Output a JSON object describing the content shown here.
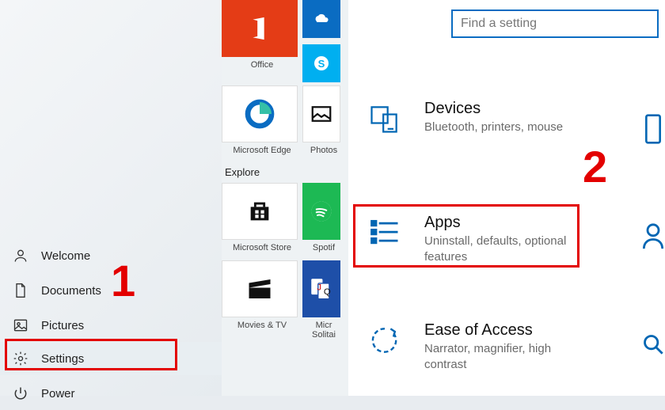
{
  "start": {
    "welcome": "Welcome",
    "documents": "Documents",
    "pictures": "Pictures",
    "settings": "Settings",
    "power": "Power"
  },
  "tiles": {
    "office": "Office",
    "edge": "Microsoft Edge",
    "photos": "Photos",
    "explore": "Explore",
    "store": "Microsoft Store",
    "spotify": "Spotif",
    "movies": "Movies & TV",
    "solitaire": "Micr\nSolitai"
  },
  "settings_window": {
    "search_placeholder": "Find a setting",
    "devices": {
      "title": "Devices",
      "sub": "Bluetooth, printers, mouse"
    },
    "apps": {
      "title": "Apps",
      "sub": "Uninstall, defaults, optional features"
    },
    "ease": {
      "title": "Ease of Access",
      "sub": "Narrator, magnifier, high contrast"
    }
  },
  "markers": {
    "one": "1",
    "two": "2"
  }
}
